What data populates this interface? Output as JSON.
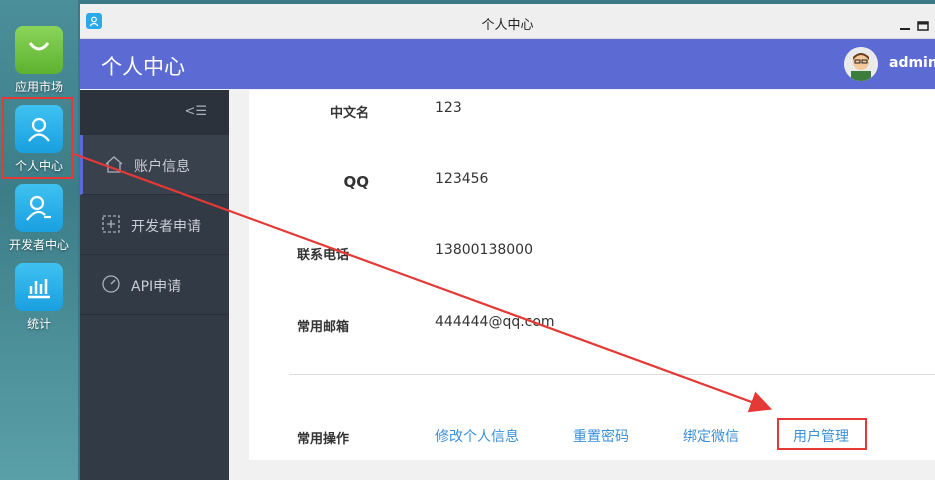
{
  "dock": {
    "items": [
      {
        "label": "应用市场",
        "icon": "shopping-bag-icon"
      },
      {
        "label": "个人中心",
        "icon": "user-icon"
      },
      {
        "label": "开发者中心",
        "icon": "developer-icon"
      },
      {
        "label": "统计",
        "icon": "bar-chart-icon"
      }
    ]
  },
  "window": {
    "title": "个人中心"
  },
  "appbar": {
    "brand": "个人中心",
    "username": "admin"
  },
  "sidebar": {
    "toggle": "<☰",
    "items": [
      {
        "label": "账户信息",
        "icon": "home-icon",
        "active": true
      },
      {
        "label": "开发者申请",
        "icon": "add-box-icon",
        "active": false
      },
      {
        "label": "API申请",
        "icon": "gauge-icon",
        "active": false
      }
    ]
  },
  "profile": {
    "fields": [
      {
        "label": "中文名",
        "value": "123"
      },
      {
        "label": "QQ",
        "value": "123456"
      },
      {
        "label": "联系电话",
        "value": "13800138000"
      },
      {
        "label": "常用邮箱",
        "value": "444444@qq.com"
      }
    ],
    "operations_label": "常用操作",
    "operations": [
      "修改个人信息",
      "重置密码",
      "绑定微信",
      "用户管理"
    ]
  },
  "colors": {
    "accent": "#5b6bd3",
    "link": "#3a8fd9",
    "highlight": "#e53935",
    "sidebar": "#323a45"
  }
}
